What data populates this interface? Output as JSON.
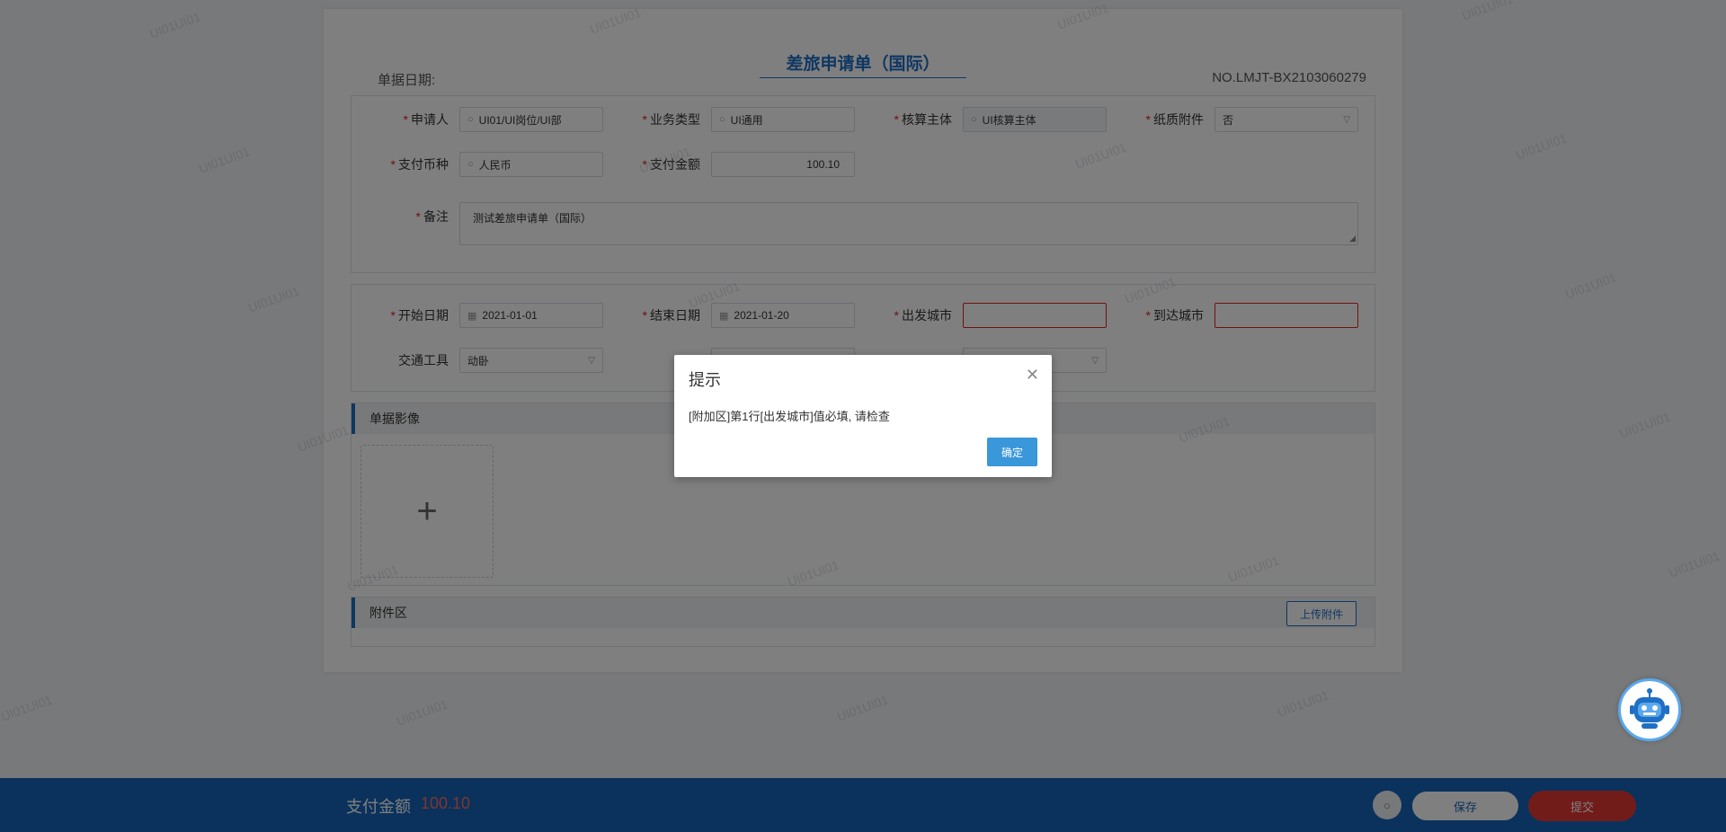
{
  "document": {
    "title": "差旅申请单（国际）",
    "date_label": "单据日期:",
    "doc_no": "NO.LMJT-BX2103060279"
  },
  "basic_info": {
    "applicant": {
      "label": "申请人",
      "value": "UI01/UI岗位/UI部"
    },
    "business_type": {
      "label": "业务类型",
      "value": "UI通用"
    },
    "accounting_entity": {
      "label": "核算主体",
      "value": "UI核算主体"
    },
    "paper_attachment": {
      "label": "纸质附件",
      "value": "否"
    },
    "currency": {
      "label": "支付币种",
      "value": "人民币"
    },
    "amount": {
      "label": "支付金额",
      "value": "100.10"
    },
    "remark": {
      "label": "备注",
      "value": "测试差旅申请单（国际）"
    }
  },
  "trip_info": {
    "start_date": {
      "label": "开始日期",
      "value": "2021-01-01"
    },
    "end_date": {
      "label": "结束日期",
      "value": "2021-01-20"
    },
    "departure_city": {
      "label": "出发城市",
      "value": ""
    },
    "arrival_city": {
      "label": "到达城市",
      "value": ""
    },
    "transport": {
      "label": "交通工具",
      "value": "动卧"
    }
  },
  "image_section": {
    "title": "单据影像",
    "add_icon": "plus-icon"
  },
  "attachment_section": {
    "title": "附件区",
    "upload_label": "上传附件"
  },
  "footer": {
    "pay_label": "支付金额",
    "pay_value": "100.10",
    "save_label": "保存",
    "submit_label": "提交"
  },
  "dialog": {
    "title": "提示",
    "message": "[附加区]第1行[出发城市]值必填, 请检查",
    "ok_label": "确定"
  },
  "watermark_text": "UI01UI01",
  "colors": {
    "primary": "#1565b8",
    "danger": "#e53935",
    "dialog_button": "#3a97d9"
  }
}
